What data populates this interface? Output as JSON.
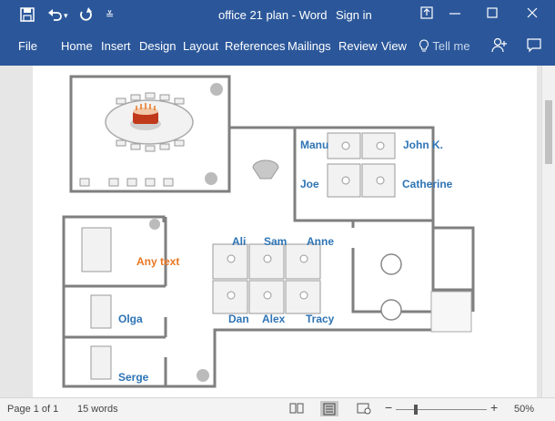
{
  "titlebar": {
    "title": "office 21 plan",
    "separator": "-",
    "app": "Word",
    "sign_in": "Sign in",
    "icons": [
      "save-icon",
      "undo-icon",
      "redo-icon",
      "customize-qat-icon",
      "ribbon-display-icon",
      "minimize-icon",
      "maximize-icon",
      "close-icon"
    ]
  },
  "ribbon": {
    "tabs": [
      "File",
      "Home",
      "Insert",
      "Design",
      "Layout",
      "References",
      "Mailings",
      "Review",
      "View"
    ],
    "tell_me": "Tell me",
    "icons": [
      "lightbulb-icon",
      "share-person-icon",
      "comments-icon"
    ]
  },
  "plan": {
    "labels": {
      "manu": "Manu",
      "john": "John K.",
      "joe": "Joe",
      "catherine": "Catherine",
      "ali": "Ali",
      "sam": "Sam",
      "anne": "Anne",
      "any_text": "Any text",
      "olga": "Olga",
      "dan": "Dan",
      "alex": "Alex",
      "tracy": "Tracy",
      "serge": "Serge"
    },
    "colors": {
      "label": "#2e74b5",
      "any_text": "#e87722",
      "wall": "#7f7f7f"
    }
  },
  "statusbar": {
    "page": "Page 1 of 1",
    "words": "15 words",
    "zoom_minus": "−",
    "zoom_plus": "+",
    "zoom": "50%",
    "zoom_level_percent": 50
  }
}
